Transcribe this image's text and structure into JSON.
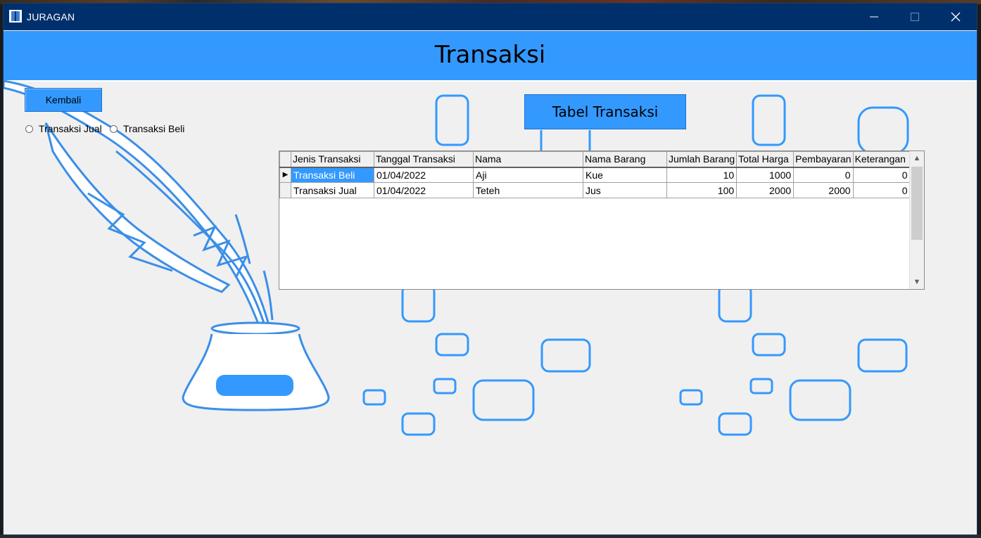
{
  "window": {
    "title": "JURAGAN",
    "controls": {
      "minimize": "—",
      "maximize": "☐",
      "close": "✕"
    }
  },
  "header": {
    "title": "Transaksi"
  },
  "back_button": {
    "label": "Kembali"
  },
  "filters": {
    "options": [
      {
        "label": "Transaksi Jual",
        "checked": false
      },
      {
        "label": "Transaksi Beli",
        "checked": false
      }
    ]
  },
  "table_button": {
    "label": "Tabel Transaksi"
  },
  "grid": {
    "columns": [
      "Jenis Transaksi",
      "Tanggal Transaksi",
      "Nama",
      "Nama Barang",
      "Jumlah Barang",
      "Total Harga",
      "Pembayaran",
      "Keterangan"
    ],
    "rows": [
      [
        "Transaksi Beli",
        "01/04/2022",
        "Aji",
        "Kue",
        "10",
        "1000",
        "0",
        "0"
      ],
      [
        "Transaksi Jual",
        "01/04/2022",
        "Teteh",
        "Jus",
        "100",
        "2000",
        "2000",
        "0"
      ]
    ],
    "current_row_marker": "▶",
    "scroll_up": "▲",
    "scroll_down": "▼"
  },
  "colors": {
    "titlebar": "#00306b",
    "header": "#3399ff",
    "accent": "#3399ff",
    "background": "#f0f0f0"
  }
}
